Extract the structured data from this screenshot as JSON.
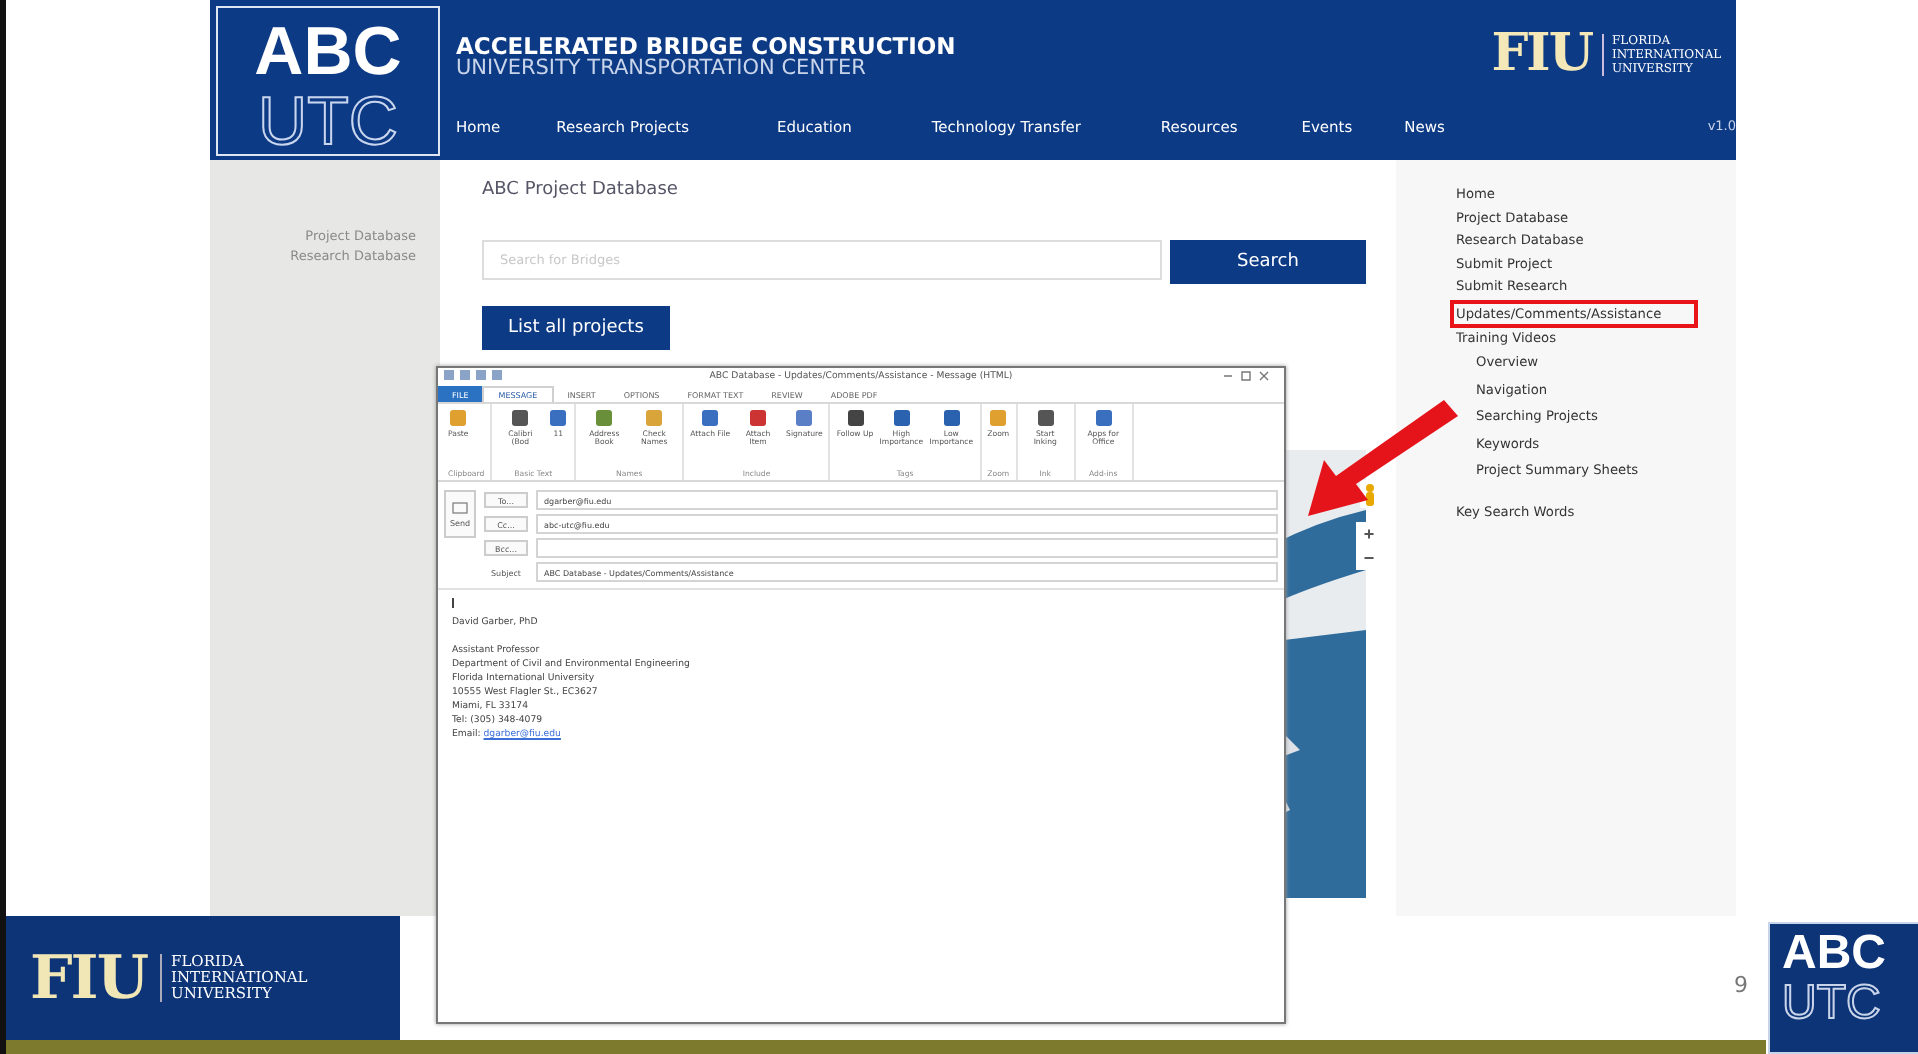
{
  "site": {
    "logo_top": "ABC",
    "logo_bottom": "UTC",
    "title": "ACCELERATED BRIDGE CONSTRUCTION",
    "subtitle": "UNIVERSITY TRANSPORTATION CENTER",
    "partner_mark": "FIU",
    "partner_name": "FLORIDA INTERNATIONAL UNIVERSITY",
    "nav": [
      {
        "label": "Home"
      },
      {
        "label": "Research Projects"
      },
      {
        "label": "Education"
      },
      {
        "label": "Technology Transfer"
      },
      {
        "label": "Resources"
      },
      {
        "label": "Events"
      },
      {
        "label": "News"
      }
    ],
    "version": "v1.0",
    "left_links": [
      "Project Database",
      "Research Database"
    ],
    "page_title": "ABC Project Database",
    "search": {
      "placeholder": "Search for Bridges"
    },
    "search_button": "Search",
    "list_button": "List all projects",
    "map": {
      "kind": "picture",
      "zoom_in": "+",
      "zoom_out": "−"
    },
    "right_menu": [
      {
        "label": "Home",
        "highlighted": false
      },
      {
        "label": "Project Database",
        "highlighted": false
      },
      {
        "label": "Research Database",
        "highlighted": false
      },
      {
        "label": "Submit Project",
        "highlighted": false
      },
      {
        "label": "Submit Research",
        "highlighted": false
      },
      {
        "label": "Updates/Comments/Assistance",
        "highlighted": true
      },
      {
        "label": "Training Videos",
        "highlighted": false,
        "children": [
          {
            "label": "Overview",
            "highlighted": false
          },
          {
            "label": "Navigation",
            "highlighted": false
          },
          {
            "label": "Searching Projects",
            "highlighted": false
          },
          {
            "label": "Keywords",
            "highlighted": false
          },
          {
            "label": "Project Summary Sheets",
            "highlighted": false
          }
        ]
      },
      {
        "label": "Key Search Words",
        "highlighted": false
      }
    ]
  },
  "email_window": {
    "title": "ABC Database - Updates/Comments/Assistance - Message (HTML)",
    "tabs": [
      {
        "label": "FILE",
        "selected": false
      },
      {
        "label": "MESSAGE",
        "selected": true
      },
      {
        "label": "INSERT",
        "selected": false
      },
      {
        "label": "OPTIONS",
        "selected": false
      },
      {
        "label": "FORMAT TEXT",
        "selected": false
      },
      {
        "label": "REVIEW",
        "selected": false
      },
      {
        "label": "ADOBE PDF",
        "selected": false
      }
    ],
    "ribbon_groups": [
      {
        "label": "Clipboard",
        "buttons": [
          "Paste"
        ]
      },
      {
        "label": "Basic Text",
        "buttons": [
          "Calibri (Bod",
          "11"
        ]
      },
      {
        "label": "Names",
        "buttons": [
          "Address Book",
          "Check Names"
        ]
      },
      {
        "label": "Include",
        "buttons": [
          "Attach File",
          "Attach Item",
          "Signature"
        ]
      },
      {
        "label": "Tags",
        "buttons": [
          "Follow Up",
          "High Importance",
          "Low Importance"
        ]
      },
      {
        "label": "Zoom",
        "buttons": [
          "Zoom"
        ]
      },
      {
        "label": "Ink",
        "buttons": [
          "Start Inking"
        ]
      },
      {
        "label": "Add-ins",
        "buttons": [
          "Apps for Office"
        ]
      }
    ],
    "send_button": "Send",
    "fields": [
      {
        "label": "To...",
        "value": "dgarber@fiu.edu"
      },
      {
        "label": "Cc...",
        "value": "abc-utc@fiu.edu"
      },
      {
        "label": "Bcc..."
      },
      {
        "label": "Subject",
        "value": "ABC Database - Updates/Comments/Assistance"
      }
    ],
    "signature_name": "David Garber, PhD",
    "signature": [
      "Assistant Professor",
      "Department of Civil and Environmental Engineering",
      "Florida International University",
      "10555 West Flagler St., EC3627",
      "Miami, FL 33174",
      "Tel: (305) 348-4079"
    ],
    "email_label": "Email:",
    "email_link": "dgarber@fiu.edu"
  },
  "slide": {
    "footer_mark": "FIU",
    "footer_name": "FLORIDA INTERNATIONAL UNIVERSITY",
    "page_number": "9",
    "corner_logo_top": "ABC",
    "corner_logo_bottom": "UTC"
  }
}
